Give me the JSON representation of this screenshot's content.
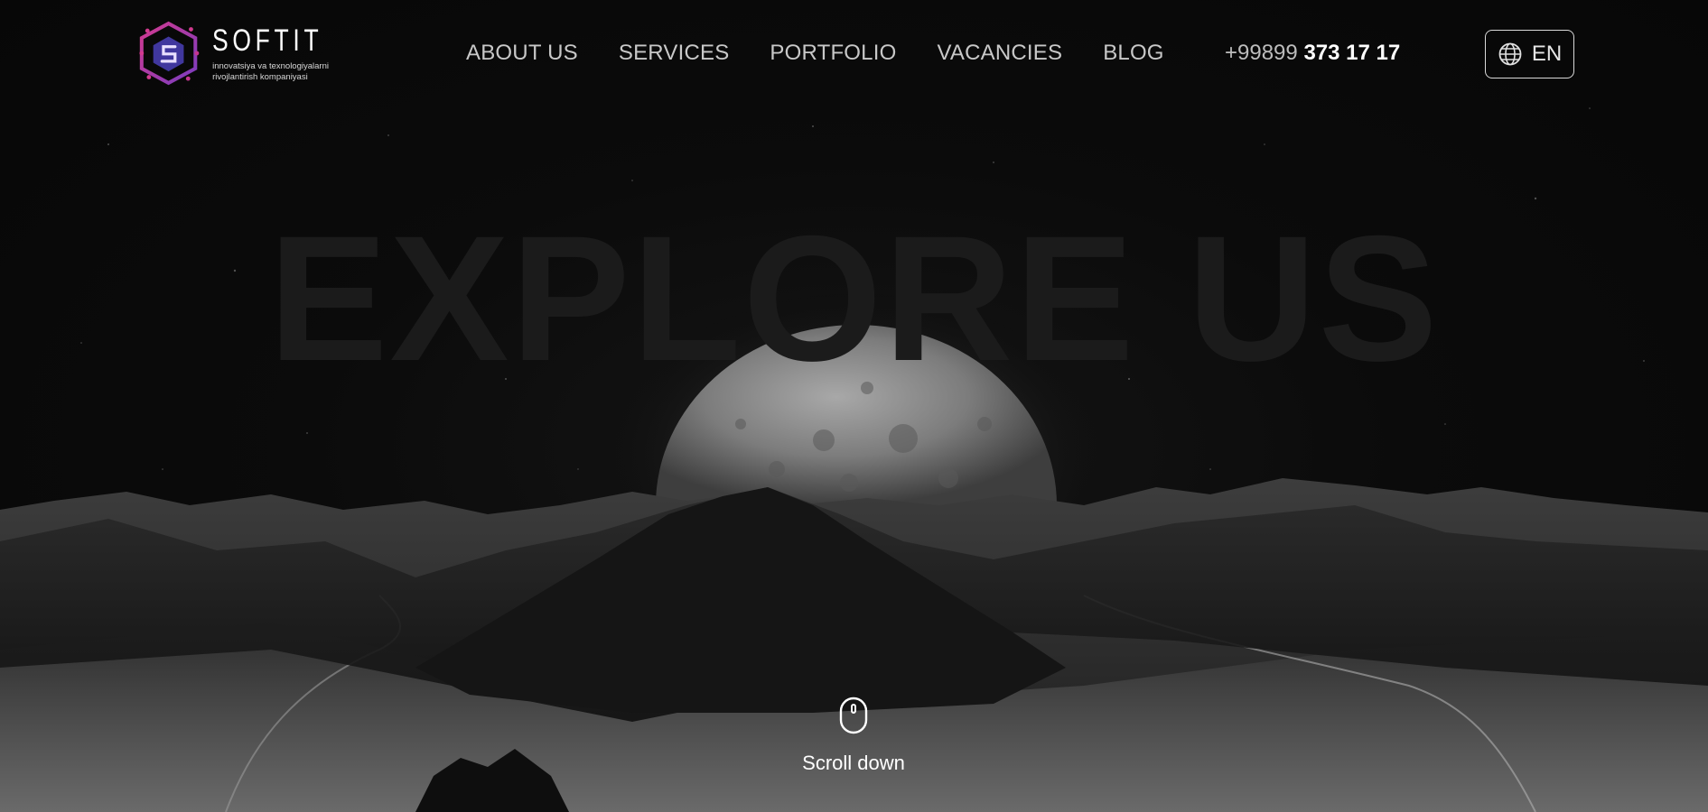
{
  "brand": {
    "name": "SOFTIT",
    "tagline": "innovatsiya va texnologiyalarni rivojlantirish kompaniyasi",
    "colors": {
      "primary": "#c4348f",
      "secondary": "#4a3fb8"
    }
  },
  "nav": {
    "items": [
      "ABOUT US",
      "SERVICES",
      "PORTFOLIO",
      "VACANCIES",
      "BLOG"
    ]
  },
  "phone": {
    "prefix": "+99899",
    "number": "373 17 17"
  },
  "language": {
    "code": "EN",
    "icon": "globe-icon"
  },
  "hero": {
    "headline": "EXPLORE US",
    "scroll_label": "Scroll down",
    "scroll_icon": "mouse-icon",
    "background": "night mountain landscape with moon"
  }
}
